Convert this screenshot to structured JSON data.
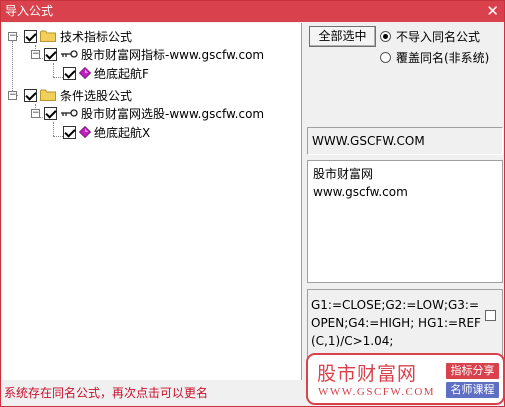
{
  "window": {
    "title": "导入公式",
    "close_glyph": "✕"
  },
  "tree": {
    "nodes": [
      {
        "label": "技术指标公式",
        "checked": true,
        "icon": "folder-icon",
        "expander": "−"
      },
      {
        "label": "股市财富网指标-www.gscfw.com",
        "checked": true,
        "icon": "key-icon",
        "expander": "−"
      },
      {
        "label": "绝底起航F",
        "checked": true,
        "icon": "formula-gem-icon"
      },
      {
        "label": "条件选股公式",
        "checked": true,
        "icon": "folder-icon",
        "expander": "−"
      },
      {
        "label": "股市财富网选股-www.gscfw.com",
        "checked": true,
        "icon": "key-icon",
        "expander": "−"
      },
      {
        "label": "绝底起航X",
        "checked": true,
        "icon": "formula-gem-icon"
      }
    ]
  },
  "options": {
    "select_all_label": "全部选中",
    "radio_skip_label": "不导入同名公式",
    "radio_overwrite_label": "覆盖同名(非系统)",
    "selected": "skip"
  },
  "formula_info": {
    "url": "WWW.GSCFW.COM",
    "description_line1": "股市财富网",
    "description_line2": "www.gscfw.com",
    "code": "G1:=CLOSE;G2:=LOW;G3:=OPEN;G4:=HIGH;\nHG1:=REF(C,1)/C>1.04;"
  },
  "status": {
    "message": "系统存在同名公式，再次点击可以更名"
  },
  "brand": {
    "name": "股市财富网",
    "domain": "WWW.GSCFW.COM",
    "tag1": "指标分享",
    "tag2": "名师课程"
  },
  "colors": {
    "accent": "#d9424c",
    "status_text": "#c8102e",
    "tag_blue": "#5f6fc4",
    "folder": "#f2cf5b",
    "gem": "#c020c0"
  }
}
